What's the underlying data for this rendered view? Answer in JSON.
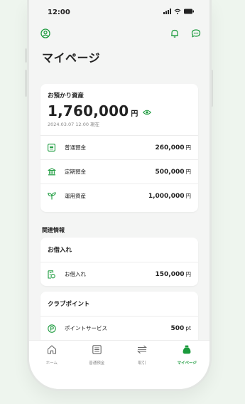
{
  "status": {
    "time": "12:00"
  },
  "page": {
    "title": "マイページ"
  },
  "assets": {
    "label": "お預かり資産",
    "total": "1,760,000",
    "unit": "円",
    "date": "2024.03.07 12:00 現在",
    "items": [
      {
        "label": "普通預金",
        "value": "260,000",
        "unit": "円",
        "icon": "list-icon"
      },
      {
        "label": "定期預金",
        "value": "500,000",
        "unit": "円",
        "icon": "bank-icon"
      },
      {
        "label": "運用資産",
        "value": "1,000,000",
        "unit": "円",
        "icon": "sprout-icon"
      }
    ]
  },
  "related": {
    "title": "関連情報",
    "loan": {
      "title": "お借入れ",
      "label": "お借入れ",
      "value": "150,000",
      "unit": "円"
    },
    "club": {
      "title": "クラブポイント",
      "label": "ポイントサービス",
      "value": "500",
      "unit": "pt"
    }
  },
  "tabs": [
    {
      "label": "ホーム",
      "icon": "home-icon"
    },
    {
      "label": "普通預金",
      "icon": "list-icon"
    },
    {
      "label": "取引",
      "icon": "transfer-icon"
    },
    {
      "label": "マイページ",
      "icon": "moneybag-icon",
      "active": true
    }
  ],
  "colors": {
    "accent": "#1a9a3c",
    "background": "#eef5ee"
  }
}
